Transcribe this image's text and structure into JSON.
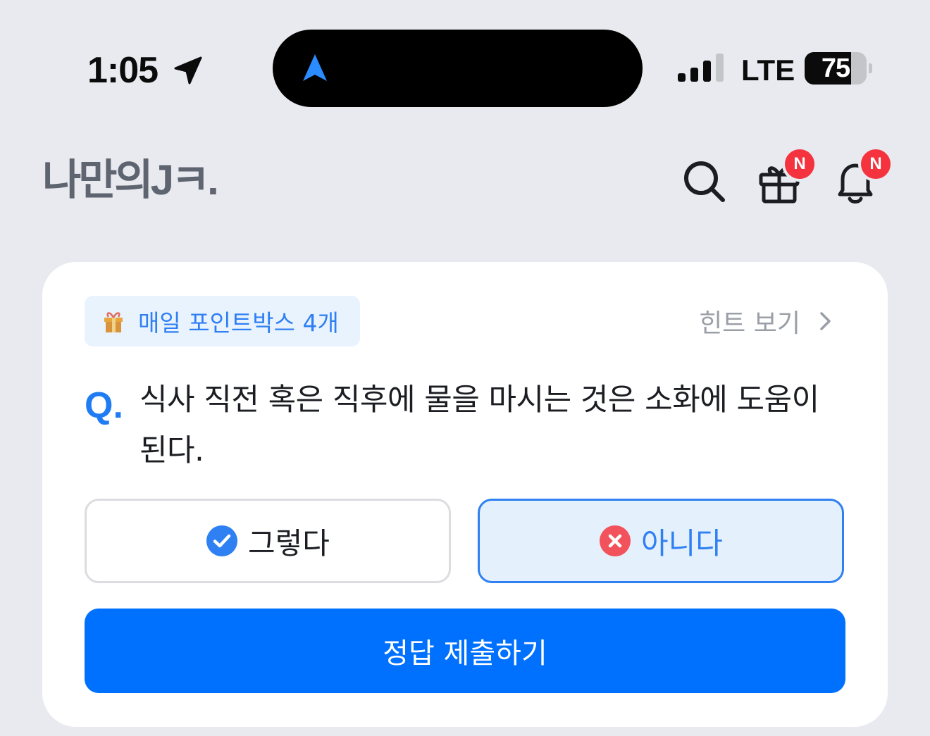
{
  "status_bar": {
    "time": "1:05",
    "network": "LTE",
    "battery_level": "75",
    "signal_bars_active": 3,
    "signal_bars_total": 4
  },
  "header": {
    "logo_text": "나만의Jㅋ.",
    "search_icon": "search-icon",
    "gift_icon": "gift-icon",
    "bell_icon": "bell-icon",
    "gift_badge": "N",
    "bell_badge": "N"
  },
  "quiz": {
    "points_chip": "매일 포인트박스 4개",
    "hint_label": "힌트 보기",
    "question_prefix": "Q.",
    "question_text": "식사 직전 혹은 직후에 물을 마시는 것은 소화에 도움이 된다.",
    "options": [
      {
        "label": "그렇다",
        "icon": "check-circle-icon",
        "selected": false
      },
      {
        "label": "아니다",
        "icon": "x-circle-icon",
        "selected": true
      }
    ],
    "submit_label": "정답 제출하기"
  },
  "colors": {
    "background": "#e9eaef",
    "accent": "#0070ff",
    "accent_text": "#2f80f2",
    "badge": "#f4333f",
    "yes_icon": "#2f80f2",
    "no_icon": "#f2525b"
  }
}
